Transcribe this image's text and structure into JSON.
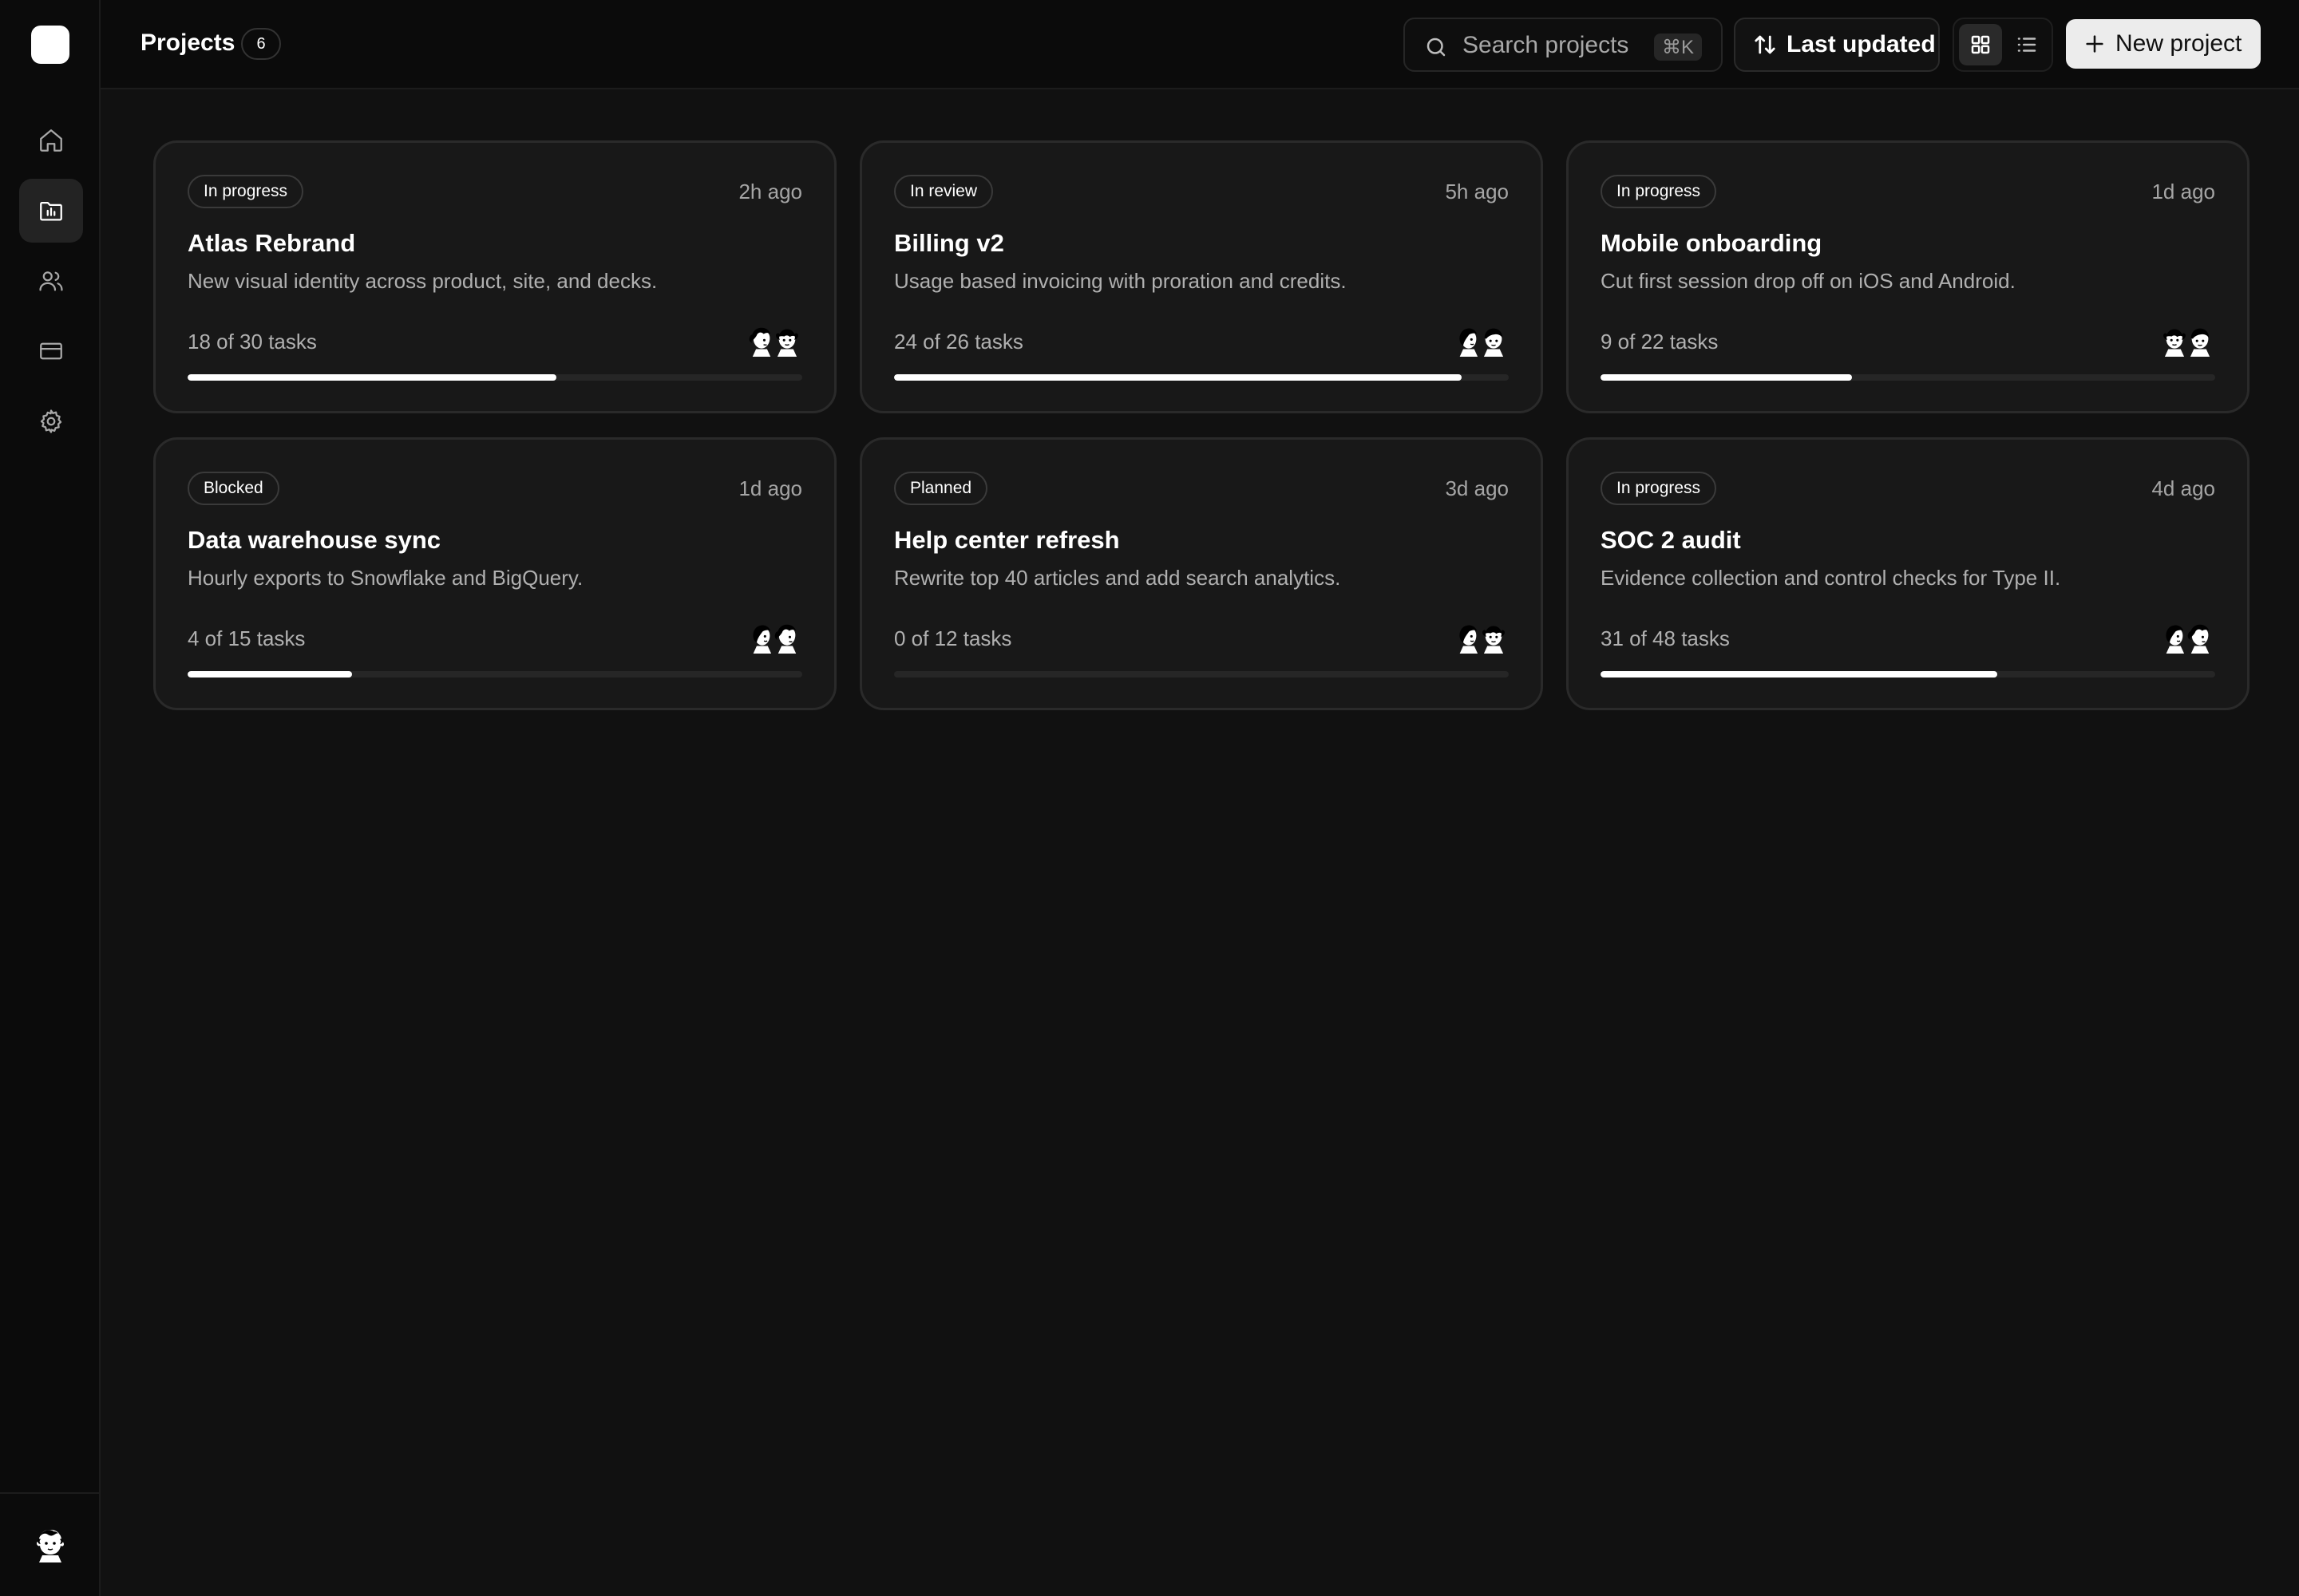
{
  "sidebar": {
    "items": [
      {
        "name": "home",
        "icon": "home-icon",
        "active": false
      },
      {
        "name": "projects",
        "icon": "folder-chart-icon",
        "active": true
      },
      {
        "name": "team",
        "icon": "users-icon",
        "active": false
      },
      {
        "name": "billing",
        "icon": "credit-card-icon",
        "active": false
      },
      {
        "name": "settings",
        "icon": "gear-icon",
        "active": false
      }
    ],
    "user_avatar_icon": "user-avatar-icon"
  },
  "header": {
    "title": "Projects",
    "count": "6",
    "search_placeholder": "Search projects",
    "search_shortcut": "⌘K",
    "sort_label": "Last updated",
    "new_project_label": "New project"
  },
  "projects": [
    {
      "status": "In progress",
      "updated": "2h ago",
      "title": "Atlas Rebrand",
      "description": "New visual identity across product, site, and decks.",
      "tasks": "18 of 30 tasks",
      "progress": 0.6
    },
    {
      "status": "In review",
      "updated": "5h ago",
      "title": "Billing v2",
      "description": "Usage based invoicing with proration and credits.",
      "tasks": "24 of 26 tasks",
      "progress": 0.923
    },
    {
      "status": "In progress",
      "updated": "1d ago",
      "title": "Mobile onboarding",
      "description": "Cut first session drop off on iOS and Android.",
      "tasks": "9 of 22 tasks",
      "progress": 0.409
    },
    {
      "status": "Blocked",
      "updated": "1d ago",
      "title": "Data warehouse sync",
      "description": "Hourly exports to Snowflake and BigQuery.",
      "tasks": "4 of 15 tasks",
      "progress": 0.267
    },
    {
      "status": "Planned",
      "updated": "3d ago",
      "title": "Help center refresh",
      "description": "Rewrite top 40 articles and add search analytics.",
      "tasks": "0 of 12 tasks",
      "progress": 0
    },
    {
      "status": "In progress",
      "updated": "4d ago",
      "title": "SOC 2 audit",
      "description": "Evidence collection and control checks for Type II.",
      "tasks": "31 of 48 tasks",
      "progress": 0.646
    }
  ]
}
